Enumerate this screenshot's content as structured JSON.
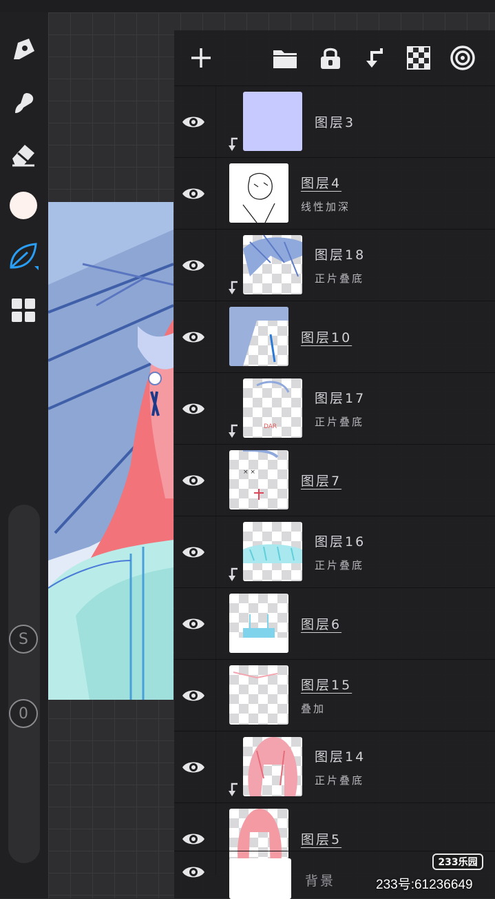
{
  "layers": [
    {
      "name": "图层3",
      "mode": "",
      "clipped": true,
      "thumb": "lavender"
    },
    {
      "name": "图层4",
      "mode": "线性加深",
      "clipped": false,
      "thumb": "lineart"
    },
    {
      "name": "图层18",
      "mode": "正片叠底",
      "clipped": true,
      "thumb": "hair-shade"
    },
    {
      "name": "图层10",
      "mode": "",
      "clipped": false,
      "thumb": "umbrella"
    },
    {
      "name": "图层17",
      "mode": "正片叠底",
      "clipped": true,
      "thumb": "face-shade"
    },
    {
      "name": "图层7",
      "mode": "",
      "clipped": false,
      "thumb": "face"
    },
    {
      "name": "图层16",
      "mode": "正片叠底",
      "clipped": true,
      "thumb": "cyan-shade"
    },
    {
      "name": "图层6",
      "mode": "",
      "clipped": false,
      "thumb": "clothes"
    },
    {
      "name": "图层15",
      "mode": "叠加",
      "clipped": false,
      "thumb": "overlay"
    },
    {
      "name": "图层14",
      "mode": "正片叠底",
      "clipped": true,
      "thumb": "pink-hair"
    },
    {
      "name": "图层5",
      "mode": "",
      "clipped": false,
      "thumb": "hair-base"
    }
  ],
  "background_layer": {
    "name": "背景"
  },
  "toolbar": {
    "icons": [
      "plus-icon",
      "folder-icon",
      "lock-icon",
      "clip-down-icon",
      "checker-icon",
      "concentric-circles-icon"
    ]
  },
  "sidebar": {
    "tools": [
      "pen-icon",
      "smudge-icon",
      "eraser-icon",
      "color-swatch",
      "leaf-brush-icon",
      "grid-icon"
    ],
    "current_color": "#fdf2ee",
    "active_accent": "#2a9df4",
    "size_slider_label": "S",
    "opacity_slider_label": "0"
  },
  "watermark": {
    "logo": "233乐园",
    "id": "233号:61236649"
  }
}
